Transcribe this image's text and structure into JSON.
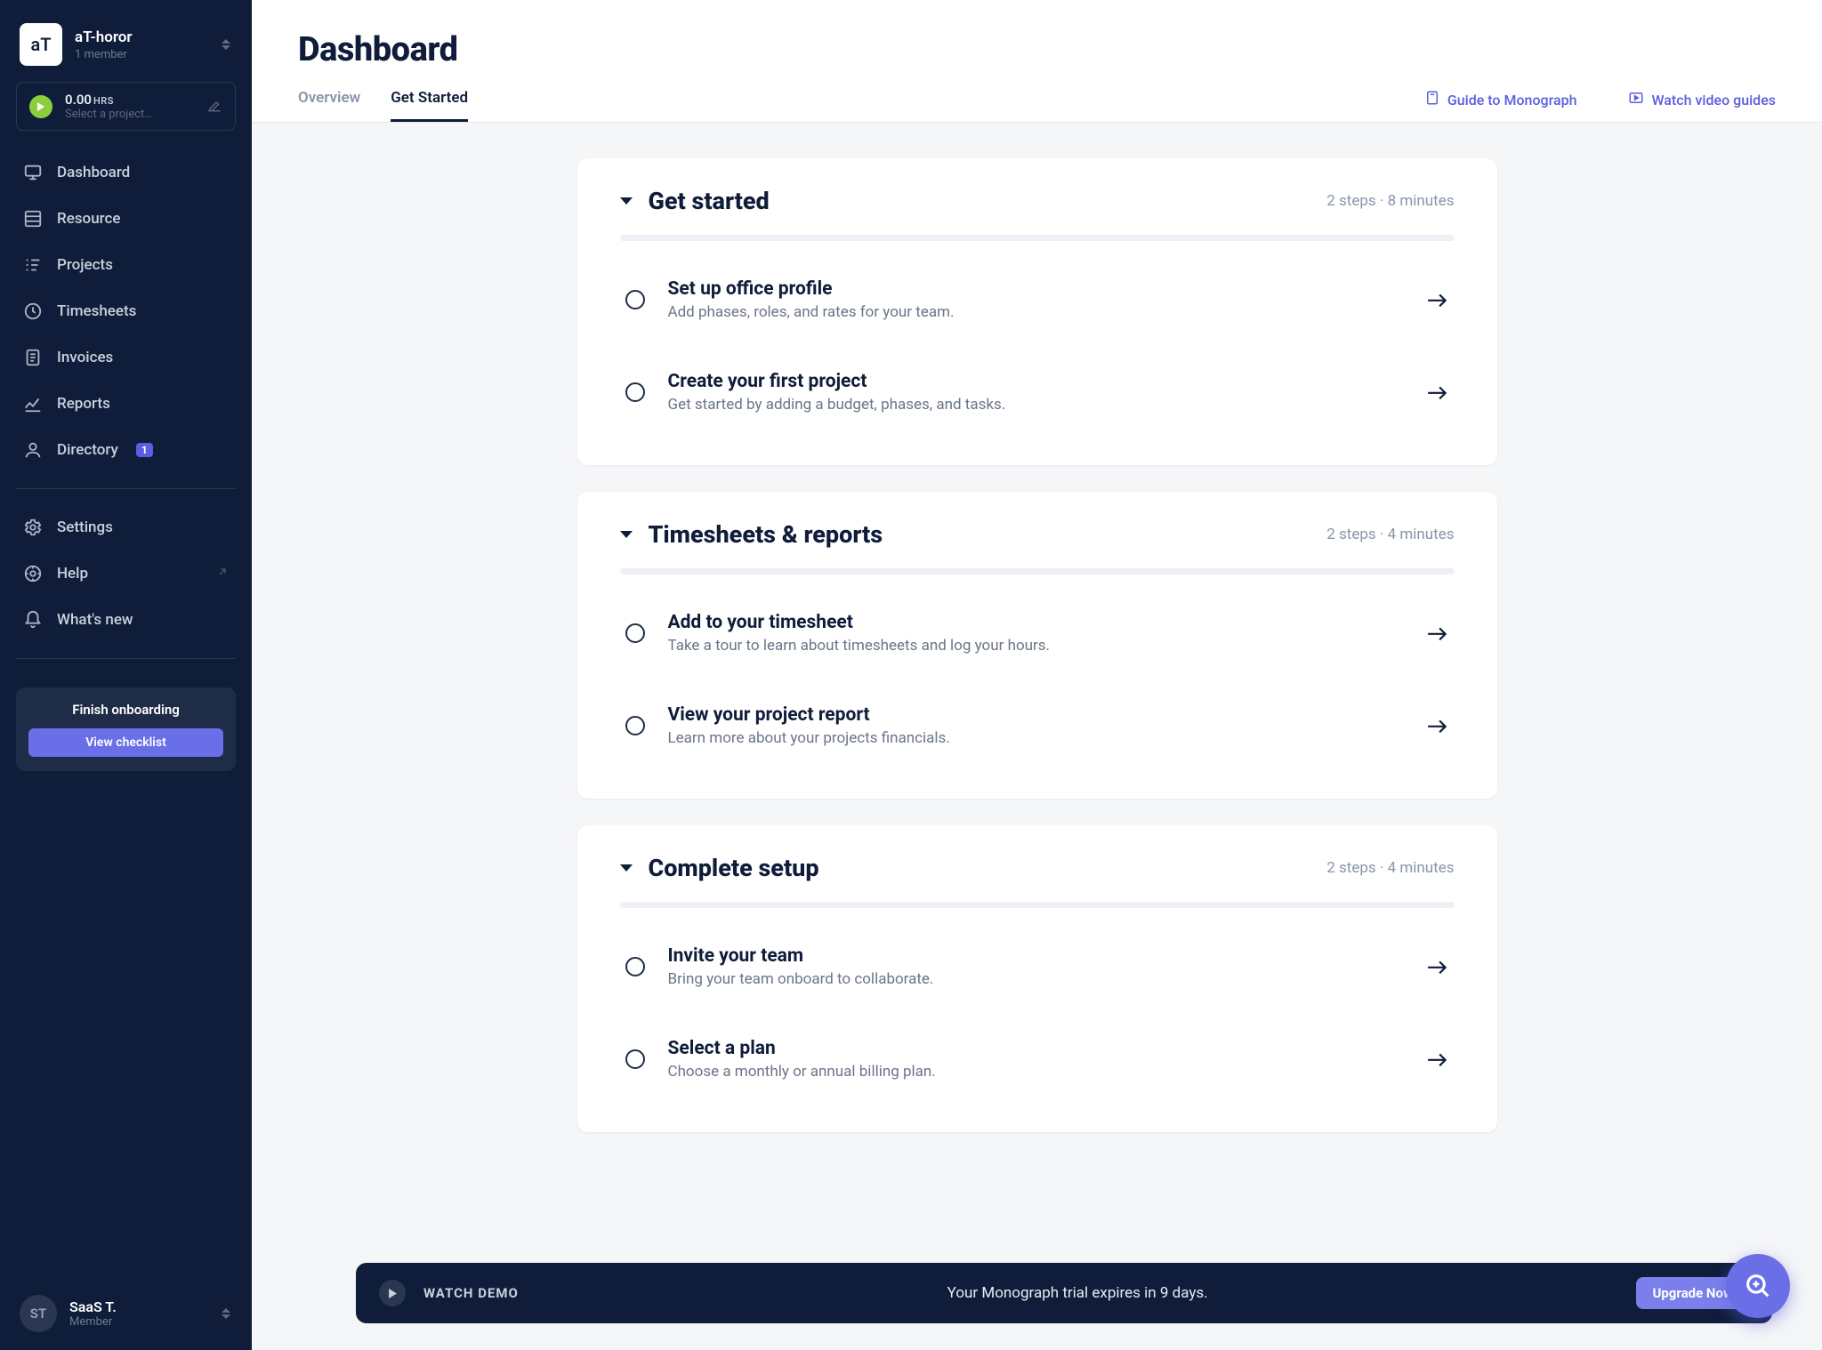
{
  "org": {
    "avatar_text": "aT",
    "name": "aT-horor",
    "subtitle": "1 member"
  },
  "timer": {
    "hours": "0.00",
    "unit": "HRS",
    "subtitle": "Select a project…"
  },
  "nav": {
    "primary": [
      {
        "label": "Dashboard"
      },
      {
        "label": "Resource"
      },
      {
        "label": "Projects"
      },
      {
        "label": "Timesheets"
      },
      {
        "label": "Invoices"
      },
      {
        "label": "Reports"
      },
      {
        "label": "Directory",
        "badge": "1"
      }
    ],
    "secondary": [
      {
        "label": "Settings"
      },
      {
        "label": "Help"
      },
      {
        "label": "What's new"
      }
    ]
  },
  "onboarding": {
    "title": "Finish onboarding",
    "button": "View checklist"
  },
  "user": {
    "initials": "ST",
    "name": "SaaS T.",
    "role": "Member"
  },
  "page": {
    "title": "Dashboard"
  },
  "tabs": [
    {
      "label": "Overview",
      "active": false
    },
    {
      "label": "Get Started",
      "active": true
    }
  ],
  "toplinks": {
    "guide": "Guide to Monograph",
    "video": "Watch video guides"
  },
  "sections": [
    {
      "title": "Get started",
      "meta": "2 steps · 8 minutes",
      "steps": [
        {
          "title": "Set up office profile",
          "subtitle": "Add phases, roles, and rates for your team."
        },
        {
          "title": "Create your first project",
          "subtitle": "Get started by adding a budget, phases, and tasks."
        }
      ]
    },
    {
      "title": "Timesheets & reports",
      "meta": "2 steps · 4 minutes",
      "steps": [
        {
          "title": "Add to your timesheet",
          "subtitle": "Take a tour to learn about timesheets and log your hours."
        },
        {
          "title": "View your project report",
          "subtitle": "Learn more about your projects financials."
        }
      ]
    },
    {
      "title": "Complete setup",
      "meta": "2 steps · 4 minutes",
      "steps": [
        {
          "title": "Invite your team",
          "subtitle": "Bring your team onboard to collaborate."
        },
        {
          "title": "Select a plan",
          "subtitle": "Choose a monthly or annual billing plan."
        }
      ]
    }
  ],
  "bottombar": {
    "demo_label": "WATCH DEMO",
    "trial_text": "Your Monograph trial expires in 9 days.",
    "upgrade": "Upgrade Now"
  }
}
